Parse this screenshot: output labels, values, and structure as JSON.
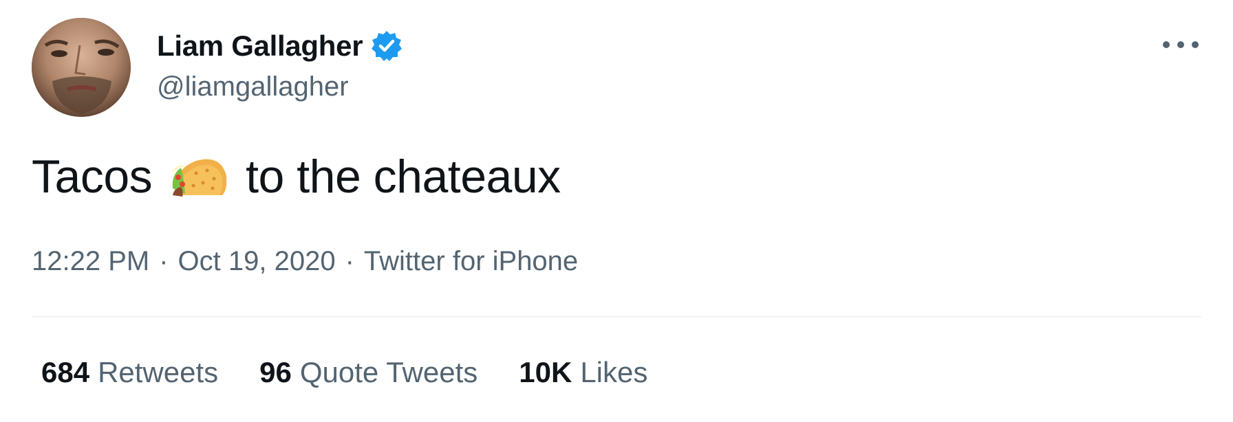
{
  "author": {
    "name": "Liam Gallagher",
    "handle": "@liamgallagher",
    "verified": true,
    "verified_color": "#1d9bf0"
  },
  "tweet": {
    "text_before_emoji": "Tacos",
    "emoji": "taco-emoji",
    "text_after_emoji": "to the chateaux"
  },
  "meta": {
    "time": "12:22 PM",
    "separator": "·",
    "date": "Oct 19, 2020",
    "source": "Twitter for iPhone"
  },
  "stats": [
    {
      "count": "684",
      "label": "Retweets"
    },
    {
      "count": "96",
      "label": "Quote Tweets"
    },
    {
      "count": "10K",
      "label": "Likes"
    }
  ],
  "colors": {
    "text_primary": "#0f1419",
    "text_secondary": "#536471",
    "divider": "#eff3f4"
  }
}
